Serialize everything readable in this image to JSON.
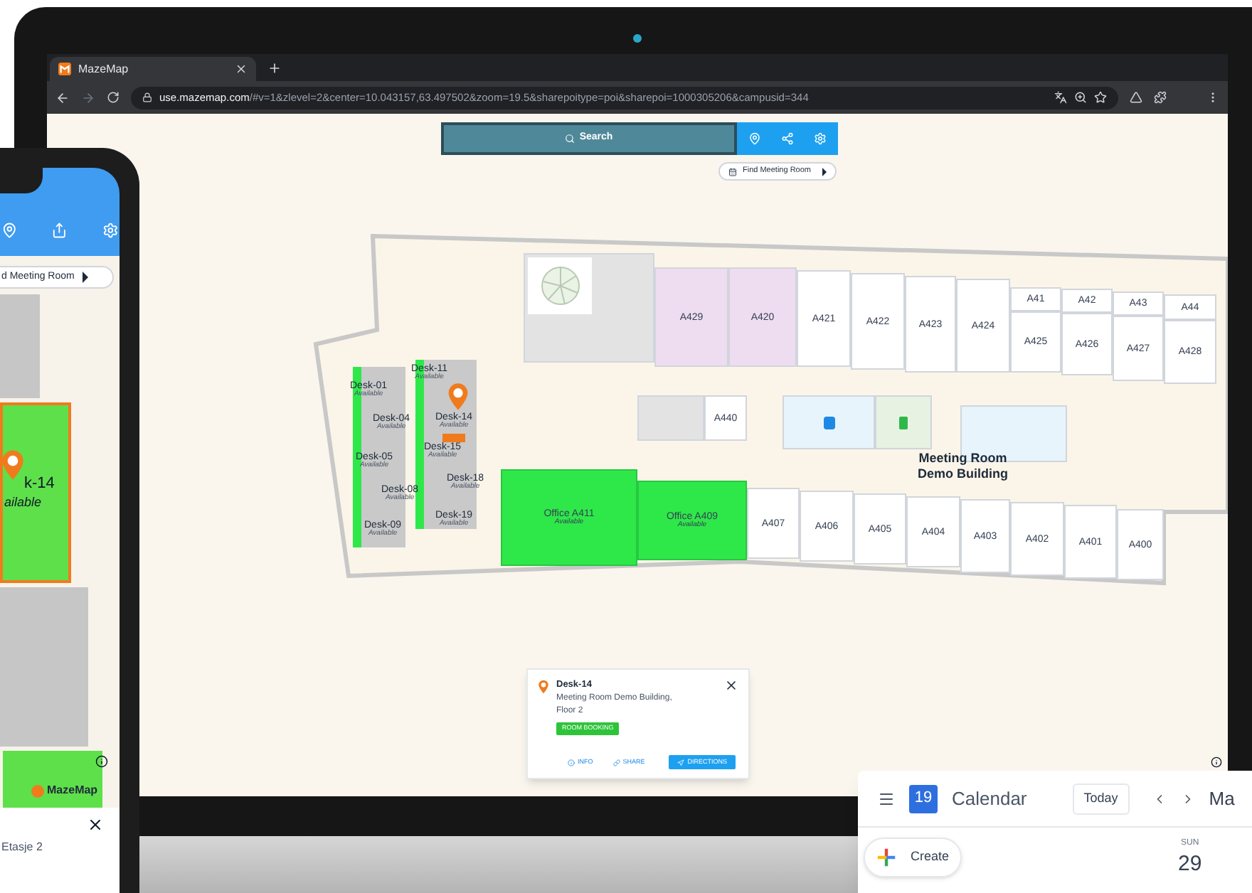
{
  "browser": {
    "tab_title": "MazeMap",
    "url_host": "use.mazemap.com",
    "url_path": "/#v=1&zlevel=2&center=10.043157,63.497502&zoom=19.5&sharepoitype=poi&sharepoi=1000305206&campusid=344"
  },
  "map": {
    "search": {
      "placeholder": "Search"
    },
    "find_button": "Find Meeting Room",
    "rooms": [
      {
        "label": "A429",
        "kind": "reserved"
      },
      {
        "label": "A420",
        "kind": "reserved"
      },
      {
        "label": "A421",
        "kind": "plain"
      },
      {
        "label": "A422",
        "kind": "plain"
      },
      {
        "label": "A423",
        "kind": "plain"
      },
      {
        "label": "A424",
        "kind": "plain"
      },
      {
        "label": "A41",
        "kind": "plain"
      },
      {
        "label": "A42",
        "kind": "plain"
      },
      {
        "label": "A43",
        "kind": "plain"
      },
      {
        "label": "A44",
        "kind": "plain"
      },
      {
        "label": "A425",
        "kind": "plain"
      },
      {
        "label": "A426",
        "kind": "plain"
      },
      {
        "label": "A427",
        "kind": "plain"
      },
      {
        "label": "A428",
        "kind": "plain"
      },
      {
        "label": "A440",
        "kind": "plain"
      },
      {
        "label": "Office A411",
        "sub": "Available",
        "kind": "available"
      },
      {
        "label": "Office A409",
        "sub": "Available",
        "kind": "available"
      },
      {
        "label": "A407",
        "kind": "plain"
      },
      {
        "label": "A406",
        "kind": "plain"
      },
      {
        "label": "A405",
        "kind": "plain"
      },
      {
        "label": "A404",
        "kind": "plain"
      },
      {
        "label": "A403",
        "kind": "plain"
      },
      {
        "label": "A402",
        "kind": "plain"
      },
      {
        "label": "A401",
        "kind": "plain"
      },
      {
        "label": "A400",
        "kind": "plain"
      }
    ],
    "desks": [
      {
        "label": "Desk-01",
        "status": "Available"
      },
      {
        "label": "Desk-04",
        "status": "Available"
      },
      {
        "label": "Desk-05",
        "status": "Available"
      },
      {
        "label": "Desk-08",
        "status": "Available"
      },
      {
        "label": "Desk-09",
        "status": "Available"
      },
      {
        "label": "Desk-11",
        "status": "Available"
      },
      {
        "label": "Desk-14",
        "status": "Available",
        "selected": true
      },
      {
        "label": "Desk-15",
        "status": "Available"
      },
      {
        "label": "Desk-18",
        "status": "Available"
      },
      {
        "label": "Desk-19",
        "status": "Available"
      }
    ],
    "building_label": [
      "Meeting Room",
      "Demo Building"
    ],
    "popup": {
      "title": "Desk-14",
      "address": "Meeting Room Demo Building, Floor 2",
      "booking_button": "ROOM BOOKING",
      "actions": [
        {
          "label": "INFO",
          "kind": "info"
        },
        {
          "label": "SHARE",
          "kind": "share"
        },
        {
          "label": "DIRECTIONS",
          "kind": "directions"
        }
      ]
    }
  },
  "phone": {
    "find_button": "d Meeting Room",
    "desk_label": "k-14",
    "desk_status": "ailable",
    "logo": "MazeMap",
    "sheet_text": "Etasje 2"
  },
  "calendar": {
    "date_icon": "19",
    "title": "Calendar",
    "today_button": "Today",
    "month": "Ma",
    "create_button": "Create",
    "day_name": "SUN",
    "day_number": "29"
  }
}
